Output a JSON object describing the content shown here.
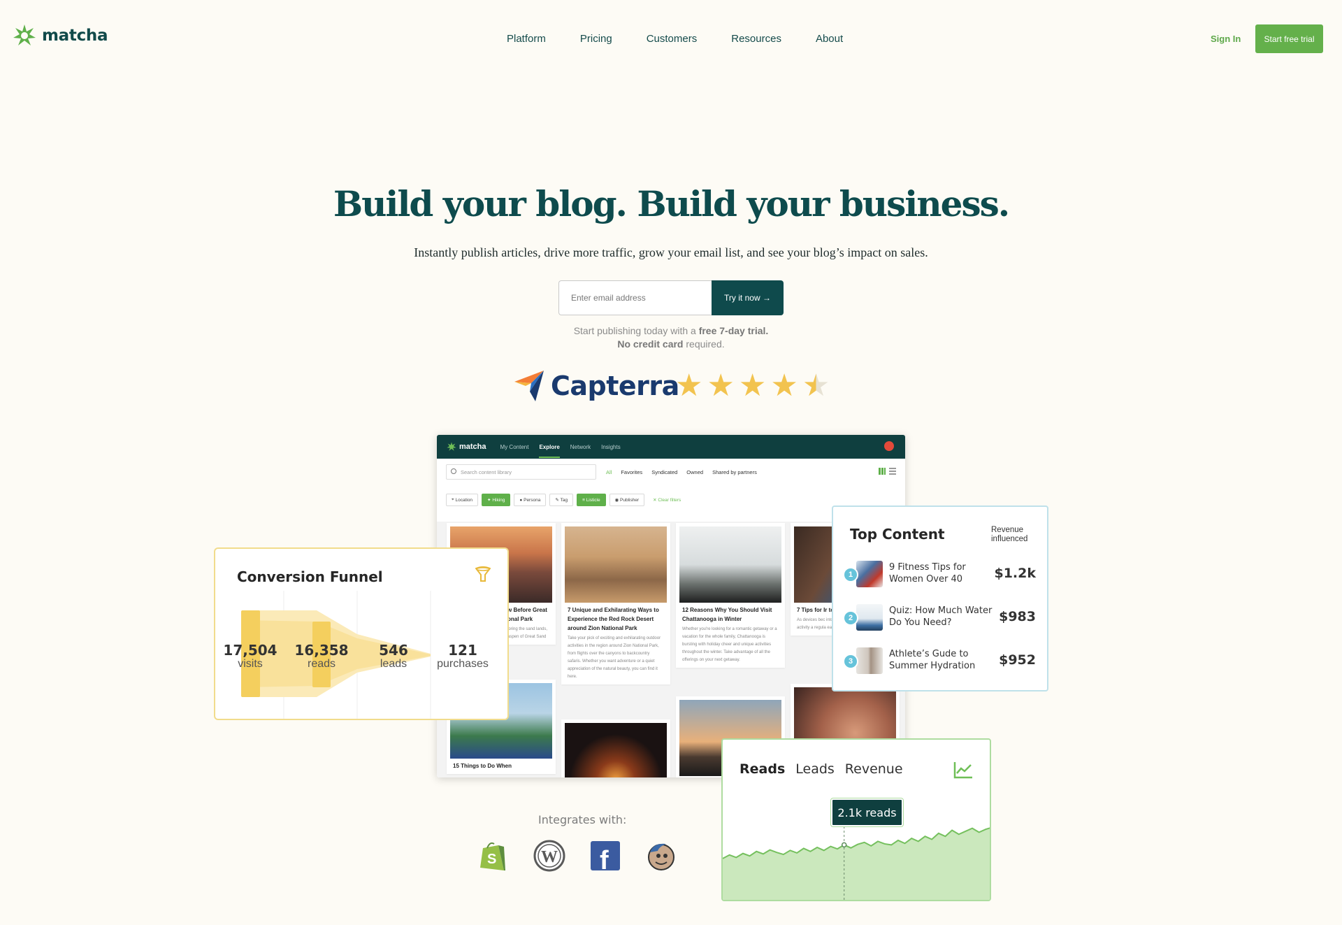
{
  "nav": {
    "brand": "matcha",
    "links": [
      "Platform",
      "Pricing",
      "Customers",
      "Resources",
      "About"
    ],
    "signin": "Sign In",
    "trial": "Start free trial"
  },
  "hero": {
    "title": "Build your blog. Build your business.",
    "subtitle": "Instantly publish articles, drive more traffic, grow your email list, and see your blog’s impact on sales.",
    "email_placeholder": "Enter email address",
    "cta": "Try it now →",
    "note_pre": "Start publishing today with a ",
    "note_bold1": "free 7-day trial.",
    "note_bold2": "No credit card",
    "note_post": " required."
  },
  "review": {
    "site": "Capterra",
    "rating": 4.5,
    "max_rating": 5
  },
  "app": {
    "brand": "matcha",
    "tabs": [
      "My Content",
      "Explore",
      "Network",
      "Insights"
    ],
    "active_tab": "Explore",
    "search_placeholder": "Search content library",
    "filter_tabs": [
      "All",
      "Favorites",
      "Syndicated",
      "Owned",
      "Shared by partners"
    ],
    "chips": [
      "Location",
      "Hiking",
      "Persona",
      "Tag",
      "Listicle",
      "Publisher"
    ],
    "active_chips": [
      "Hiking",
      "Listicle"
    ],
    "clear": "Clear filters",
    "cards": [
      {
        "title": "w Before Great onal Park",
        "body": "loring the sand lands, aspen of Great Sand"
      },
      {
        "title": "7 Unique and Exhilarating Ways to Experience the Red Rock Desert around Zion National Park",
        "body": "Take your pick of exciting and exhilarating outdoor activities in the region around Zion National Park, from flights over the canyons to backcountry safaris. Whether you want adventure or a quiet appreciation of the natural beauty, you can find it here."
      },
      {
        "title": "12 Reasons Why You Should Visit Chattanooga in Winter",
        "body": "Whether you're looking for a romantic getaway or a vacation for the whole family, Chattanooga is bursting with holiday cheer and unique activities throughout the winter. Take advantage of all the offerings on your next getaway."
      },
      {
        "title": "7 Tips for Ir to Outdoor A",
        "body": "As devices bec into a child's de important than activity a regula early age."
      },
      {
        "title": "15 Things to Do When",
        "body": ""
      }
    ]
  },
  "funnel": {
    "title": "Conversion Funnel",
    "stages": [
      {
        "value": "17,504",
        "label": "visits"
      },
      {
        "value": "16,358",
        "label": "reads"
      },
      {
        "value": "546",
        "label": "leads"
      },
      {
        "value": "121",
        "label": "purchases"
      }
    ]
  },
  "top_content": {
    "title": "Top Content",
    "revenue_header": "Revenue influenced",
    "items": [
      {
        "rank": "1",
        "title": "9 Fitness Tips for Women Over 40",
        "value": "$1.2k"
      },
      {
        "rank": "2",
        "title": "Quiz: How Much Water Do You Need?",
        "value": "$983"
      },
      {
        "rank": "3",
        "title": "Athlete’s Gude to Summer Hydration",
        "value": "$952"
      }
    ]
  },
  "reads_chart": {
    "tabs": [
      "Reads",
      "Leads",
      "Revenue"
    ],
    "active": "Reads",
    "tooltip": "2.1k reads",
    "line": [
      0.28,
      0.35,
      0.3,
      0.38,
      0.33,
      0.42,
      0.37,
      0.45,
      0.4,
      0.36,
      0.44,
      0.39,
      0.48,
      0.42,
      0.5,
      0.44,
      0.52,
      0.47,
      0.55,
      0.49,
      0.56,
      0.6,
      0.53,
      0.62,
      0.57,
      0.55,
      0.64,
      0.58,
      0.68,
      0.62,
      0.72,
      0.66,
      0.78,
      0.72,
      0.84,
      0.76,
      0.82,
      0.88,
      0.8,
      0.86,
      0.9
    ],
    "fill_color": "#cbe8bd",
    "line_color": "#75c05e"
  },
  "integrations": {
    "title": "Integrates with:",
    "icons": [
      "shopify-icon",
      "wordpress-icon",
      "facebook-icon",
      "mailchimp-icon"
    ]
  },
  "colors": {
    "primary": "#0f4a4c",
    "accent": "#64b04b",
    "funnel": "#f7d36a",
    "star": "#f2c34f"
  }
}
